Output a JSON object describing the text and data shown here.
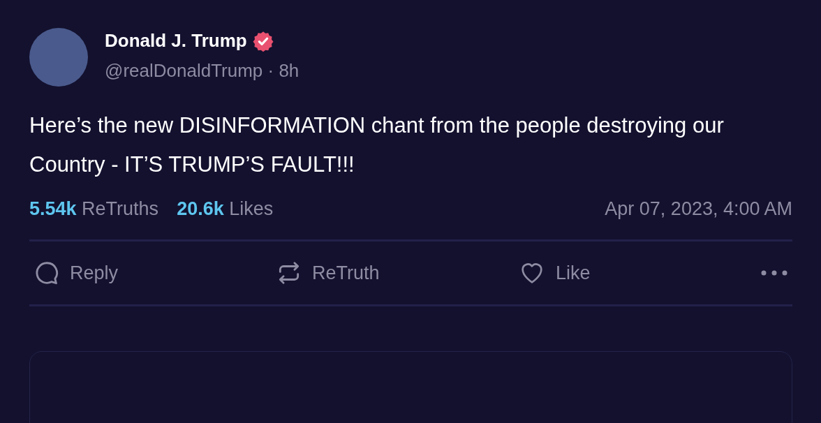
{
  "post": {
    "author": {
      "name": "Donald J. Trump",
      "verified": true,
      "handle_line": "@realDonaldTrump · 8h"
    },
    "text": "Here’s the new DISINFORMATION chant from the people destroying our Country - IT’S TRUMP’S FAULT!!!",
    "stats": [
      {
        "count": "5.54k",
        "label": "ReTruths"
      },
      {
        "count": "20.6k",
        "label": "Likes"
      }
    ],
    "timestamp": "Apr 07, 2023, 4:00 AM",
    "actions": [
      {
        "kind": "reply",
        "label": "Reply"
      },
      {
        "kind": "retruth",
        "label": "ReTruth"
      },
      {
        "kind": "like",
        "label": "Like"
      },
      {
        "kind": "more"
      }
    ]
  }
}
